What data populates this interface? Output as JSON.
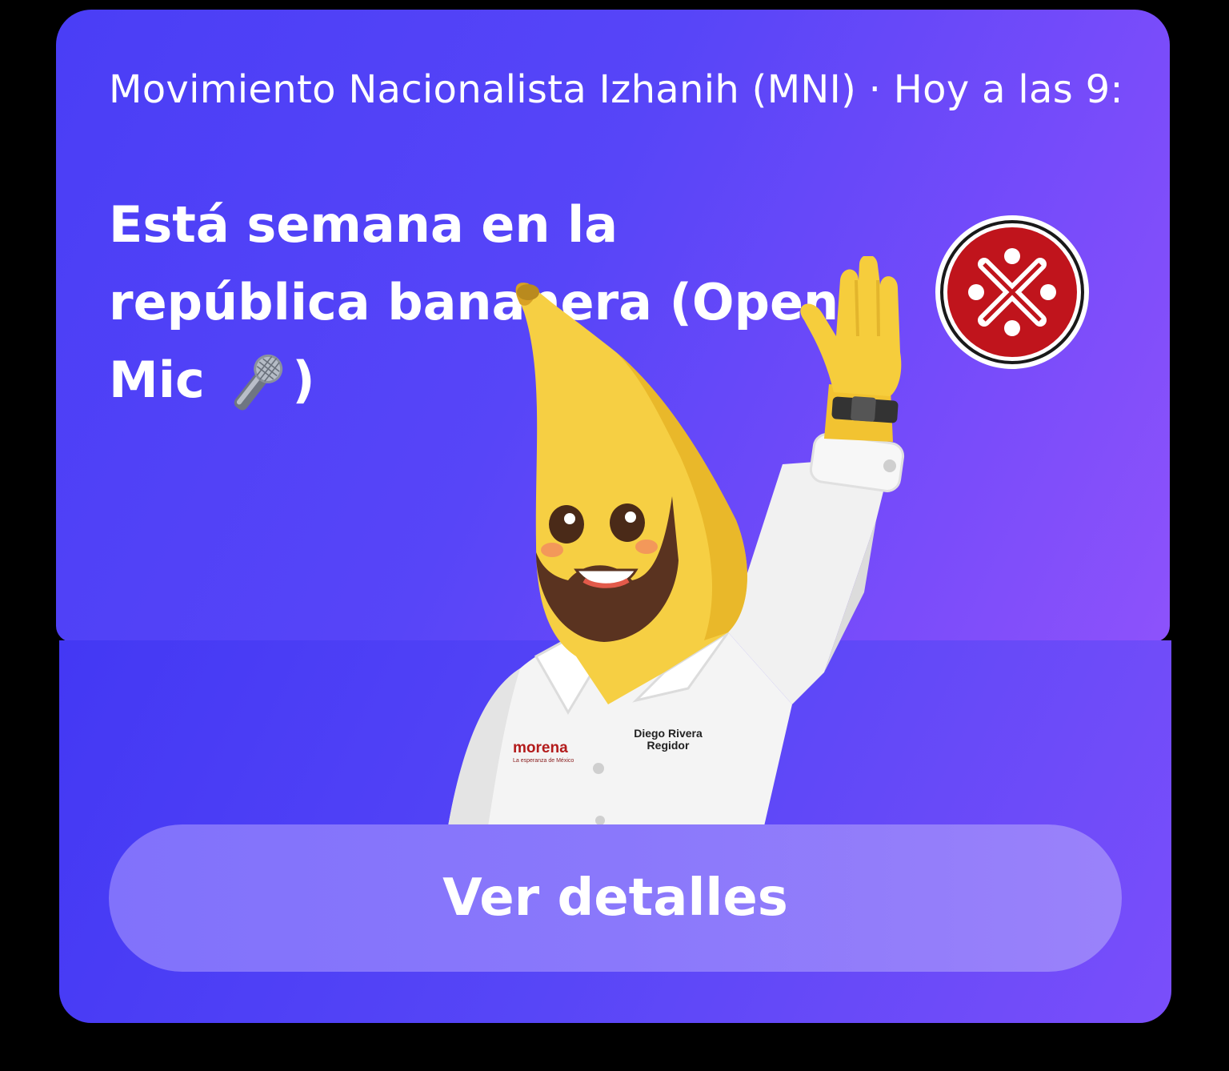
{
  "post": {
    "meta": "Movimiento Nacionalista Izhanih (MNI) · Hoy a las 9:(",
    "title_part1": "Está semana en la república bananera (Open Mic ",
    "title_emoji": "microphone-icon",
    "title_part2": ")"
  },
  "mascot": {
    "shirt_logo": "morena",
    "shirt_tagline": "La esperanza de México",
    "name_tag_line1": "Diego Rivera",
    "name_tag_line2": "Regidor"
  },
  "action": {
    "label": "Ver detalles"
  },
  "colors": {
    "card": "#5745f8",
    "button": "#8a78fb",
    "badge_red": "#c0141c"
  }
}
